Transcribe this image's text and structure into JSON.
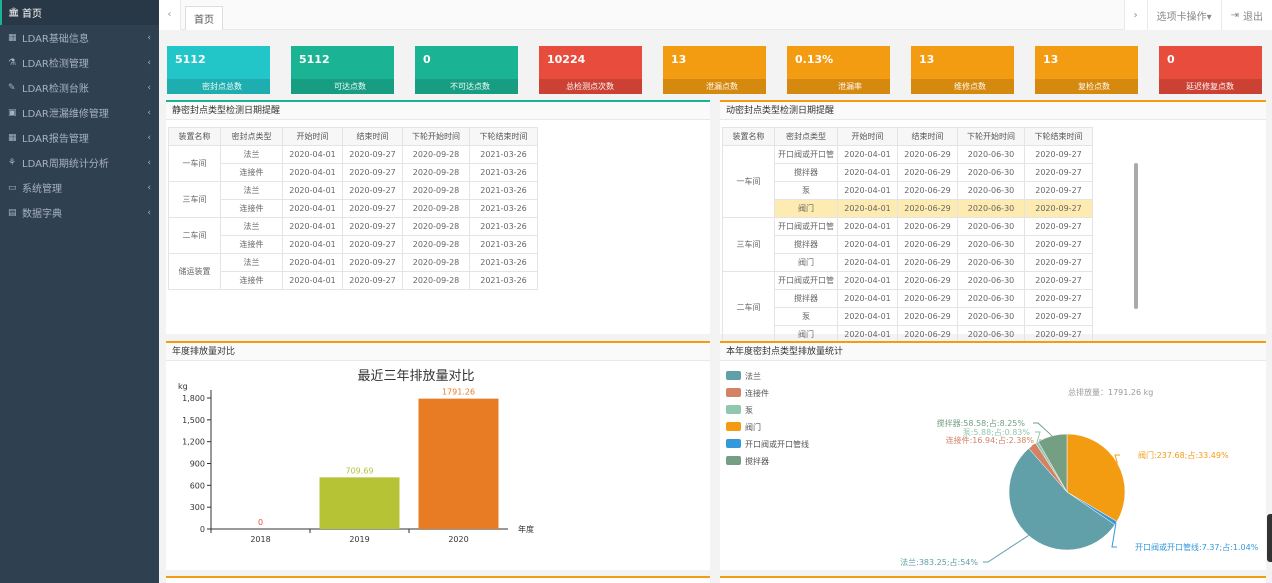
{
  "sidebar": {
    "items": [
      {
        "label": "首页",
        "icon": "bank-icon"
      },
      {
        "label": "LDAR基础信息",
        "icon": "grid-icon"
      },
      {
        "label": "LDAR检测管理",
        "icon": "flask-icon"
      },
      {
        "label": "LDAR检测台账",
        "icon": "brush-icon"
      },
      {
        "label": "LDAR泄漏维修管理",
        "icon": "image-icon"
      },
      {
        "label": "LDAR报告管理",
        "icon": "grid-icon"
      },
      {
        "label": "LDAR周期统计分析",
        "icon": "sitemap-icon"
      },
      {
        "label": "系统管理",
        "icon": "monitor-icon"
      },
      {
        "label": "数据字典",
        "icon": "book-icon"
      }
    ]
  },
  "tabbar": {
    "tab": "首页",
    "options": "选项卡操作▾",
    "logout": "退出"
  },
  "stats": [
    {
      "value": "5112",
      "label": "密封点总数",
      "color": "#23c6c8"
    },
    {
      "value": "5112",
      "label": "可达点数",
      "color": "#1ab394"
    },
    {
      "value": "0",
      "label": "不可达点数",
      "color": "#1ab394"
    },
    {
      "value": "10224",
      "label": "总检测点次数",
      "color": "#e74c3c"
    },
    {
      "value": "13",
      "label": "泄漏点数",
      "color": "#f39c12"
    },
    {
      "value": "0.13%",
      "label": "泄漏率",
      "color": "#f39c12"
    },
    {
      "value": "13",
      "label": "维修点数",
      "color": "#f39c12"
    },
    {
      "value": "13",
      "label": "复检点数",
      "color": "#f39c12"
    },
    {
      "value": "0",
      "label": "延迟修复点数",
      "color": "#e74c3c"
    }
  ],
  "static_panel": {
    "title": "静密封点类型检测日期提醒",
    "headers": [
      "装置名称",
      "密封点类型",
      "开始时间",
      "结束时间",
      "下轮开始时间",
      "下轮结束时间"
    ],
    "groups": [
      {
        "unit": "一车间",
        "rows": [
          [
            "法兰",
            "2020-04-01",
            "2020-09-27",
            "2020-09-28",
            "2021-03-26"
          ],
          [
            "连接件",
            "2020-04-01",
            "2020-09-27",
            "2020-09-28",
            "2021-03-26"
          ]
        ]
      },
      {
        "unit": "三车间",
        "rows": [
          [
            "法兰",
            "2020-04-01",
            "2020-09-27",
            "2020-09-28",
            "2021-03-26"
          ],
          [
            "连接件",
            "2020-04-01",
            "2020-09-27",
            "2020-09-28",
            "2021-03-26"
          ]
        ]
      },
      {
        "unit": "二车间",
        "rows": [
          [
            "法兰",
            "2020-04-01",
            "2020-09-27",
            "2020-09-28",
            "2021-03-26"
          ],
          [
            "连接件",
            "2020-04-01",
            "2020-09-27",
            "2020-09-28",
            "2021-03-26"
          ]
        ]
      },
      {
        "unit": "储运装置",
        "rows": [
          [
            "法兰",
            "2020-04-01",
            "2020-09-27",
            "2020-09-28",
            "2021-03-26"
          ],
          [
            "连接件",
            "2020-04-01",
            "2020-09-27",
            "2020-09-28",
            "2021-03-26"
          ]
        ]
      }
    ]
  },
  "dynamic_panel": {
    "title": "动密封点类型检测日期提醒",
    "headers": [
      "装置名称",
      "密封点类型",
      "开始时间",
      "结束时间",
      "下轮开始时间",
      "下轮结束时间"
    ],
    "groups": [
      {
        "unit": "一车间",
        "rows": [
          [
            "开口阀或开口管",
            "2020-04-01",
            "2020-06-29",
            "2020-06-30",
            "2020-09-27",
            false
          ],
          [
            "搅拌器",
            "2020-04-01",
            "2020-06-29",
            "2020-06-30",
            "2020-09-27",
            false
          ],
          [
            "泵",
            "2020-04-01",
            "2020-06-29",
            "2020-06-30",
            "2020-09-27",
            false
          ],
          [
            "阀门",
            "2020-04-01",
            "2020-06-29",
            "2020-06-30",
            "2020-09-27",
            true
          ]
        ]
      },
      {
        "unit": "三车间",
        "rows": [
          [
            "开口阀或开口管",
            "2020-04-01",
            "2020-06-29",
            "2020-06-30",
            "2020-09-27",
            false
          ],
          [
            "搅拌器",
            "2020-04-01",
            "2020-06-29",
            "2020-06-30",
            "2020-09-27",
            false
          ],
          [
            "阀门",
            "2020-04-01",
            "2020-06-29",
            "2020-06-30",
            "2020-09-27",
            false
          ]
        ]
      },
      {
        "unit": "二车间",
        "rows": [
          [
            "开口阀或开口管",
            "2020-04-01",
            "2020-06-29",
            "2020-06-30",
            "2020-09-27",
            false
          ],
          [
            "搅拌器",
            "2020-04-01",
            "2020-06-29",
            "2020-06-30",
            "2020-09-27",
            false
          ],
          [
            "泵",
            "2020-04-01",
            "2020-06-29",
            "2020-06-30",
            "2020-09-27",
            false
          ],
          [
            "阀门",
            "2020-04-01",
            "2020-06-29",
            "2020-06-30",
            "2020-09-27",
            false
          ]
        ]
      }
    ]
  },
  "bar_panel": {
    "title": "年度排放量对比"
  },
  "pie_panel": {
    "title": "本年度密封点类型排放量统计"
  },
  "chart_data": [
    {
      "type": "bar",
      "title": "最近三年排放量对比",
      "ylabel": "kg",
      "xlabel": "年度",
      "categories": [
        "2018",
        "2019",
        "2020"
      ],
      "values": [
        0,
        709.69,
        1791.26
      ],
      "value_labels": [
        "0",
        "709.69",
        "1791.26"
      ],
      "colors": [
        "#e74c3c",
        "#b5c334",
        "#e87c25"
      ],
      "yticks": [
        "0",
        "300",
        "600",
        "900",
        "1,200",
        "1,500",
        "1,800"
      ],
      "ylim": [
        0,
        1800
      ]
    },
    {
      "type": "pie",
      "total_label": "总排放量：1791.26 kg",
      "legend": [
        "法兰",
        "连接件",
        "泵",
        "阀门",
        "开口阀或开口管线",
        "搅拌器"
      ],
      "slices": [
        {
          "name": "法兰",
          "value": 383.25,
          "percent": 54,
          "color": "#61a0a8",
          "label": "法兰:383.25;占:54%"
        },
        {
          "name": "连接件",
          "value": 16.94,
          "percent": 2.38,
          "color": "#d48265",
          "label": "连接件:16.94;占:2.38%"
        },
        {
          "name": "泵",
          "value": 5.88,
          "percent": 0.83,
          "color": "#91c7ae",
          "label": "泵:5.88;占:0.83%"
        },
        {
          "name": "阀门",
          "value": 237.68,
          "percent": 33.49,
          "color": "#f39c12",
          "label": "阀门:237.68;占:33.49%"
        },
        {
          "name": "开口阀或开口管线",
          "value": 7.37,
          "percent": 1.04,
          "color": "#3498db",
          "label": "开口阀或开口管线:7.37;占:1.04%"
        },
        {
          "name": "搅拌器",
          "value": 58.58,
          "percent": 8.25,
          "color": "#749f83",
          "label": "搅拌器:58.58;占:8.25%"
        }
      ]
    }
  ]
}
